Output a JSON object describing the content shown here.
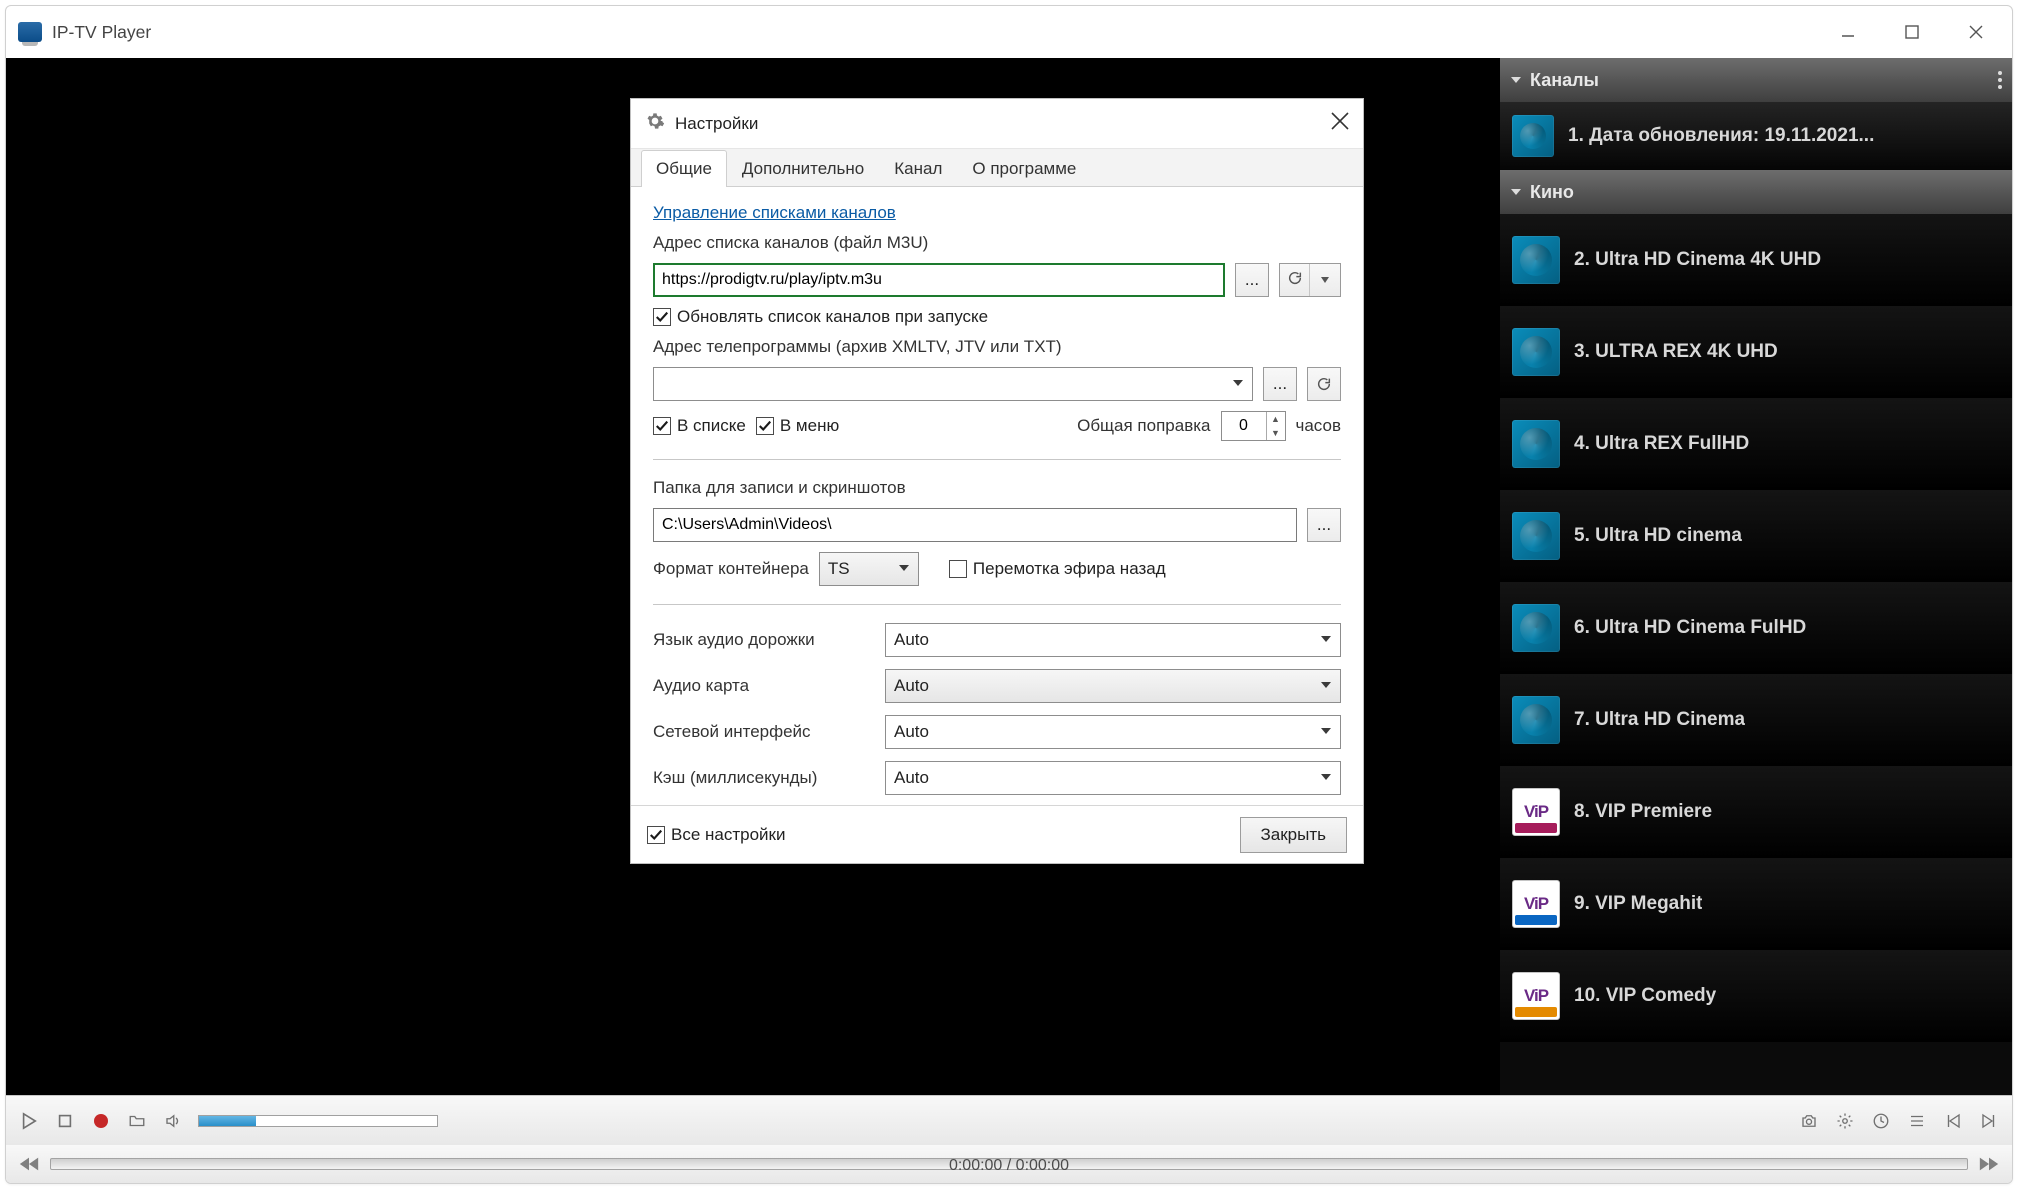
{
  "window": {
    "title": "IP-TV Player"
  },
  "channels": {
    "header": "Каналы",
    "group_cinema": "Кино",
    "list": [
      {
        "label": "1. Дата обновления: 19.11.2021...",
        "kind": "std"
      },
      {
        "label": "2. Ultra HD Cinema 4K UHD",
        "kind": "std"
      },
      {
        "label": "3. ULTRA REX 4K UHD",
        "kind": "std"
      },
      {
        "label": "4. Ultra REX FullHD",
        "kind": "std"
      },
      {
        "label": "5. Ultra HD cinema",
        "kind": "std"
      },
      {
        "label": "6. Ultra HD Cinema FulHD",
        "kind": "std"
      },
      {
        "label": "7. Ultra HD Cinema",
        "kind": "std"
      },
      {
        "label": "8. VIP Premiere",
        "kind": "vip-premiere"
      },
      {
        "label": "9. VIP Megahit",
        "kind": "vip-megahit"
      },
      {
        "label": "10. VIP Comedy",
        "kind": "vip-comedy"
      }
    ]
  },
  "dialog": {
    "title": "Настройки",
    "tabs": {
      "general": "Общие",
      "advanced": "Дополнительно",
      "channel": "Канал",
      "about": "О программе"
    },
    "manage_link": "Управление списками каналов",
    "m3u_label": "Адрес списка каналов (файл M3U)",
    "m3u_value": "https://prodigtv.ru/play/iptv.m3u",
    "update_checkbox": "Обновлять список каналов при запуске",
    "epg_label": "Адрес телепрограммы (архив XMLTV, JTV или TXT)",
    "epg_value": "",
    "in_list": "В списке",
    "in_menu": "В меню",
    "offset_label": "Общая поправка",
    "offset_value": "0",
    "hours_label": "часов",
    "folder_label": "Папка для записи и скриншотов",
    "folder_value": "C:\\Users\\Admin\\Videos\\",
    "container_label": "Формат контейнера",
    "container_value": "TS",
    "rewind_label": "Перемотка эфира назад",
    "audio_track_label": "Язык аудио дорожки",
    "audio_track_value": "Auto",
    "audio_card_label": "Аудио карта",
    "audio_card_value": "Auto",
    "net_iface_label": "Сетевой интерфейс",
    "net_iface_value": "Auto",
    "cache_label": "Кэш (миллисекунды)",
    "cache_value": "Auto",
    "all_settings": "Все настройки",
    "close_btn": "Закрыть",
    "browse_ellipsis": "..."
  },
  "player": {
    "time": "0:00:00 / 0:00:00"
  }
}
